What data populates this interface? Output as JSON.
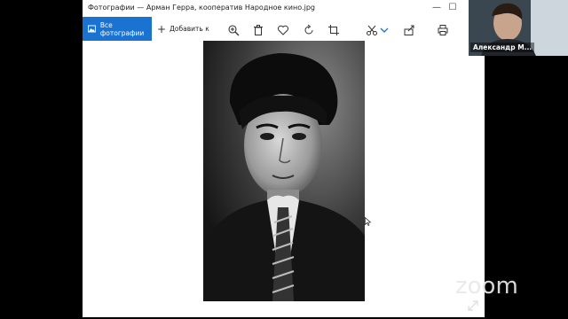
{
  "window": {
    "title": "Фотографии — Арман Герра, кооператив Народное кино.jpg",
    "minimize": "—",
    "maximize": "☐"
  },
  "toolbar": {
    "all_photos_label": "Все фотографии",
    "add_to_label": "Добавить к",
    "accent": "#1a73d1"
  },
  "video": {
    "participant_name": "Александр М..."
  },
  "watermark": {
    "brand": "zoom"
  }
}
